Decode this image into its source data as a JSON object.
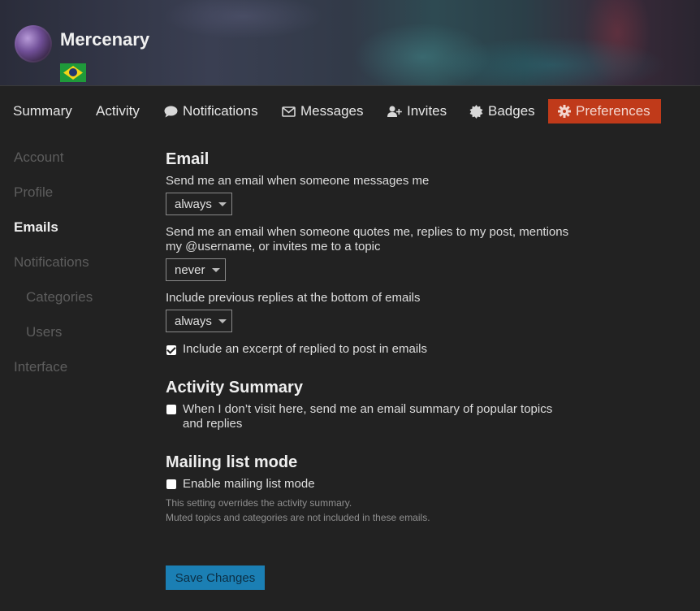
{
  "profile": {
    "username": "Mercenary",
    "flag": "brazil-flag"
  },
  "tabs": [
    {
      "label": "Summary",
      "icon": ""
    },
    {
      "label": "Activity",
      "icon": ""
    },
    {
      "label": "Notifications",
      "icon": "comment-icon"
    },
    {
      "label": "Messages",
      "icon": "envelope-icon"
    },
    {
      "label": "Invites",
      "icon": "user-plus-icon"
    },
    {
      "label": "Badges",
      "icon": "certificate-icon"
    },
    {
      "label": "Preferences",
      "icon": "gear-icon",
      "active": true
    }
  ],
  "sidebar": {
    "items": [
      {
        "label": "Account"
      },
      {
        "label": "Profile"
      },
      {
        "label": "Emails",
        "active": true
      },
      {
        "label": "Notifications"
      },
      {
        "label": "Categories"
      },
      {
        "label": "Users"
      },
      {
        "label": "Interface"
      }
    ]
  },
  "email": {
    "heading": "Email",
    "messages_label": "Send me an email when someone messages me",
    "messages_value": "always",
    "quotes_label": "Send me an email when someone quotes me, replies to my post, mentions my @username, or invites me to a topic",
    "quotes_value": "never",
    "previous_label": "Include previous replies at the bottom of emails",
    "previous_value": "always",
    "excerpt_label": "Include an excerpt of replied to post in emails",
    "excerpt_checked": true
  },
  "activity_summary": {
    "heading": "Activity Summary",
    "label": "When I don’t visit here, send me an email summary of popular topics and replies",
    "checked": false
  },
  "mailing_list": {
    "heading": "Mailing list mode",
    "label": "Enable mailing list mode",
    "checked": false,
    "note1": "This setting overrides the activity summary.",
    "note2": "Muted topics and categories are not included in these emails."
  },
  "actions": {
    "save_label": "Save Changes"
  },
  "colors": {
    "accent": "#c03a1a",
    "save_button": "#1b7fb4",
    "background": "#222222"
  }
}
